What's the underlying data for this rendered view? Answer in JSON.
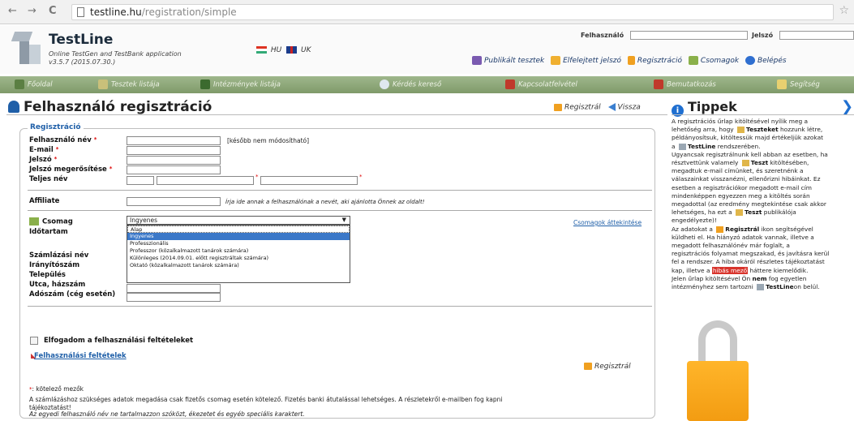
{
  "browser": {
    "back": "←",
    "forward": "→",
    "reload": "C",
    "url_host": "testline.hu",
    "url_path": "/registration/simple",
    "star": "☆"
  },
  "header": {
    "brand": "TestLine",
    "tagline_1": "Online TestGen and TestBank application",
    "tagline_2": "v3.5.7 (2015.07.30.)",
    "lang_hu": "HU",
    "lang_uk": "UK",
    "login_user_label": "Felhasználó",
    "login_pass_label": "Jelszó",
    "links": [
      "Publikált tesztek",
      "Elfelejtett jelszó",
      "Regisztráció",
      "Csomagok",
      "Belépés"
    ]
  },
  "nav": [
    "Főoldal",
    "Tesztek listája",
    "Intézmények listája",
    "Kérdés kereső",
    "Kapcsolatfelvétel",
    "Bemutatkozás",
    "Segítség"
  ],
  "page": {
    "title": "Felhasználó regisztráció",
    "submit": "Regisztrál",
    "back": "Vissza"
  },
  "form": {
    "legend": "Regisztráció",
    "username": "Felhasználó név",
    "email": "E-mail",
    "password": "Jelszó",
    "password_confirm": "Jelszó megerősítése",
    "fullname": "Teljes név",
    "username_note": "[később nem módosítható]",
    "affiliate": "Affiliate",
    "affiliate_note": "Írja ide annak a felhasználónak a nevét, aki ajánlotta Önnek az oldalt!",
    "package": "Csomag",
    "duration": "Időtartam",
    "package_selected": "Ingyenes",
    "package_options": [
      "Alap",
      "Ingyenes",
      "Professzionális",
      "Professzor (közalkalmazott tanárok számára)",
      "Különleges (2014.09.01. előtt regisztráltak számára)",
      "Oktató (közalkalmazott tanárok számára)"
    ],
    "packages_link": "Csomagok áttekintése",
    "billing_name": "Számlázási név",
    "zip": "Irányítószám",
    "city": "Település",
    "street": "Utca, házszám",
    "tax": "Adószám (cég esetén)",
    "accept": "Elfogadom a felhasználási feltételeket",
    "terms_link": "Felhasználási feltételek",
    "required_legend": ": kötelező mezők",
    "billing_note_1": "A számlázáshoz szükséges adatok megadása csak fizetős csomag esetén kötelező. Fizetés banki átutalással lehetséges. A részletekről e-mailben fog kapni",
    "billing_note_2": "tájékoztatást!",
    "final_note": "Az egyedi felhasználó név ne tartalmazzon szóközt, ékezetet és egyéb speciális karaktert."
  },
  "tips": {
    "title": "Tippek",
    "l1": "A regisztrációs űrlap kitöltésével nyílik meg a",
    "l2a": "lehetőség arra, hogy",
    "l2b": "Teszteket",
    "l2c": "hozzunk létre,",
    "l3": "példányosítsuk, kitöltessük majd értékeljük azokat",
    "l4a": "a",
    "l4b": "TestLine",
    "l4c": "rendszerében.",
    "l5": "Ugyancsak regisztrálnunk kell abban az esetben, ha",
    "l6a": "résztvettünk valamely",
    "l6b": "Teszt",
    "l6c": "kitöltésében,",
    "l7": "megadtuk e-mail címünket, és szeretnénk a",
    "l8": "válaszainkat visszanézni, ellenőrizni hibáinkat. Ez",
    "l9": "esetben a regisztrációkor megadott e-mail cím",
    "l10": "mindenképpen egyezzen meg a kitöltés során",
    "l11": "megadottal (az eredmény megtekintése csak akkor",
    "l12a": "lehetséges, ha ezt a",
    "l12b": "Teszt",
    "l12c": "publikálója",
    "l13": "engedélyezte)!",
    "l14a": "Az adatokat a",
    "l14b": "Regisztrál",
    "l14c": "ikon segítségével",
    "l15": "küldheti el. Ha hiányzó adatok vannak, illetve a",
    "l16": "megadott felhasználónév már foglalt, a",
    "l17": "regisztrációs folyamat megszakad, és javításra kerül",
    "l18": "fel a rendszer. A hiba okáról részletes tájékoztatást",
    "l19a": "kap, illetve a",
    "l19b": "hibás mező",
    "l19c": "háttere kiemelődik.",
    "l20a": "Jelen űrlap kitöltésével Ön",
    "l20b": "nem",
    "l20c": "fog egyetlen",
    "l21a": "intézményhez sem tartozni",
    "l21b": "TestLine",
    "l21c": "on belül."
  },
  "colors": {
    "nav_bar": "#8aa575",
    "link": "#1f5fa8",
    "highlight": "#d8342c",
    "lock": "#f5a623",
    "selected_option": "#3b78c8"
  }
}
